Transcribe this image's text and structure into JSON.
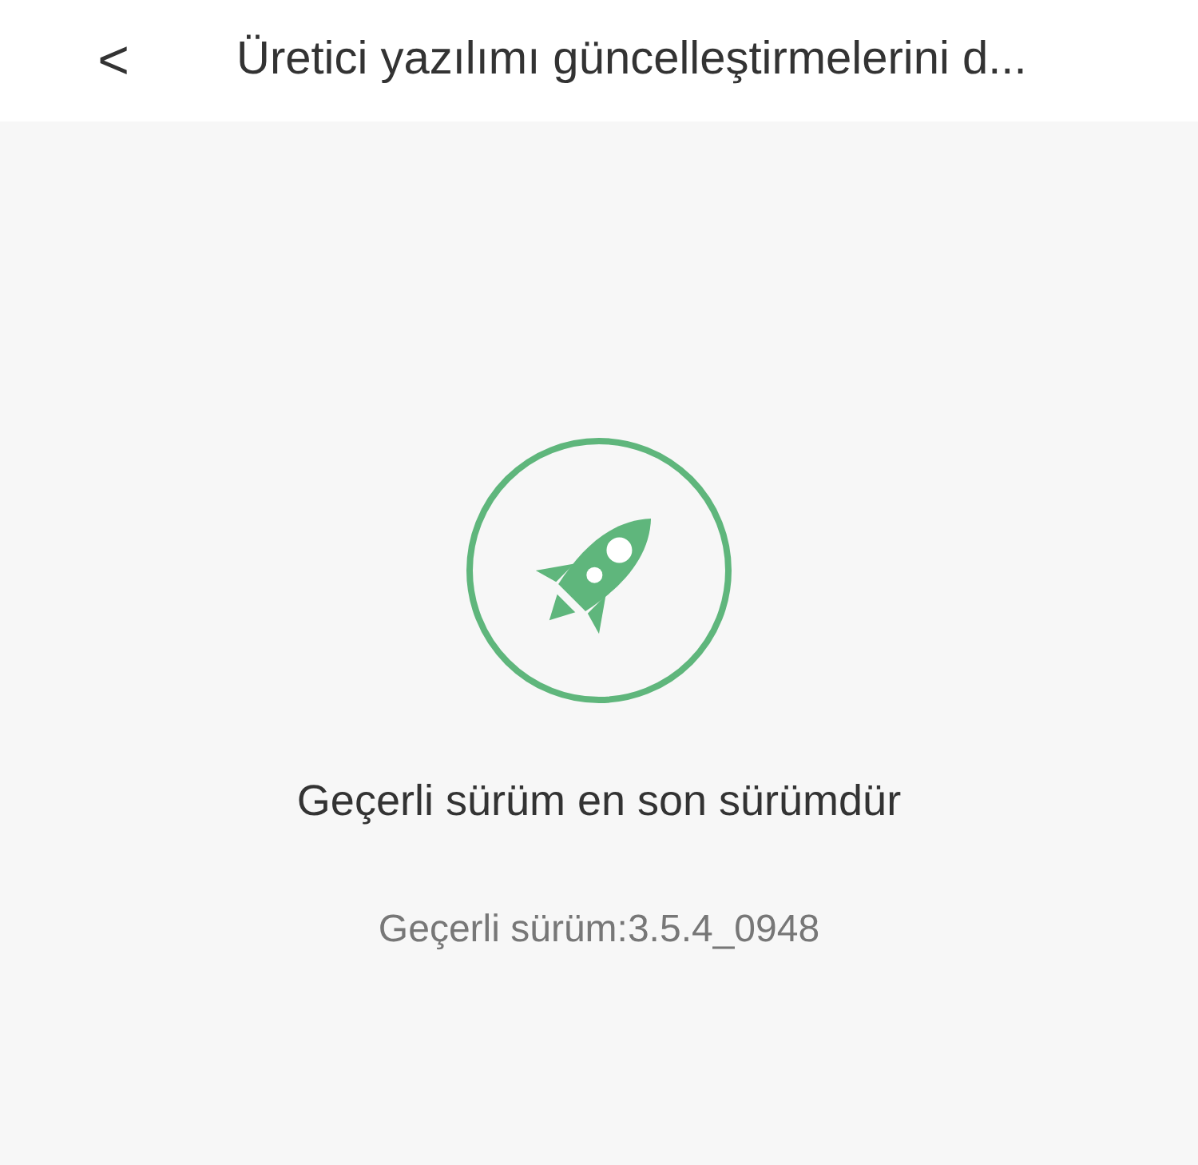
{
  "header": {
    "back": "<",
    "title": "Üretici yazılımı güncelleştirmelerini d..."
  },
  "status": {
    "message": "Geçerli sürüm en son sürümdür",
    "version": "Geçerli sürüm:3.5.4_0948"
  }
}
